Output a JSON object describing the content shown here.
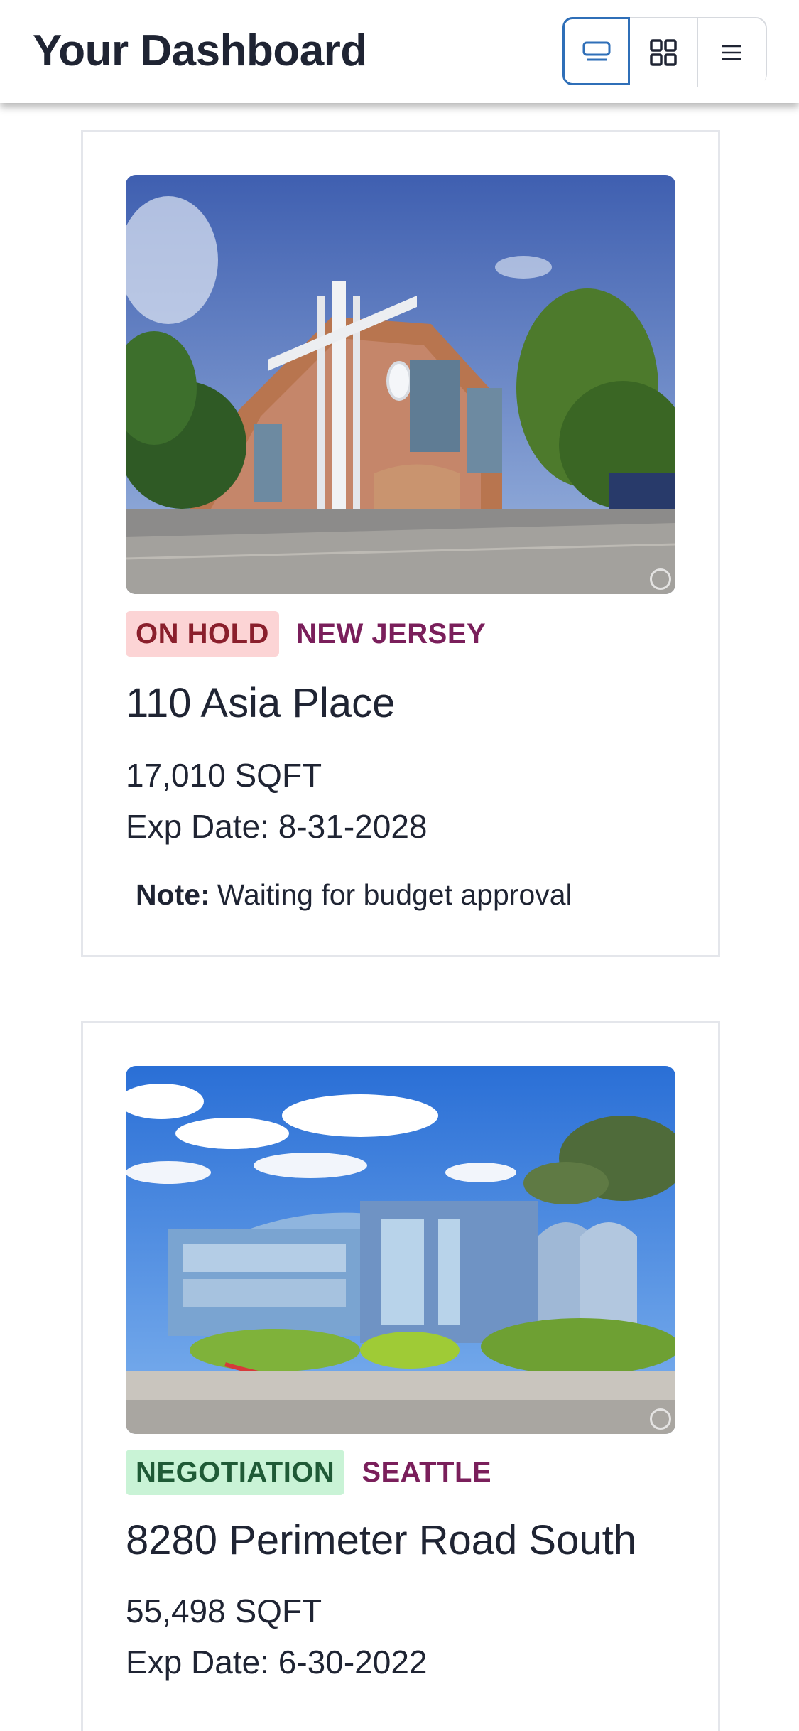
{
  "header": {
    "title": "Your Dashboard",
    "view_buttons": [
      {
        "icon": "card-view-icon",
        "active": true
      },
      {
        "icon": "grid-view-icon",
        "active": false
      },
      {
        "icon": "list-view-icon",
        "active": false
      }
    ]
  },
  "properties": [
    {
      "status": "ON HOLD",
      "location": "NEW JERSEY",
      "name": "110 Asia Place",
      "sqft": "17,010 SQFT",
      "exp": "Exp Date: 8-31-2028",
      "note_label": "Note:",
      "note_text": "Waiting for budget approval"
    },
    {
      "status": "NEGOTIATION",
      "location": "SEATTLE",
      "name": "8280 Perimeter Road South",
      "sqft": "55,498 SQFT",
      "exp": "Exp Date: 6-30-2022"
    }
  ],
  "colors": {
    "accent": "#2f6fb8",
    "on_hold_bg": "#fcd4d5",
    "on_hold_text": "#8a1f2c",
    "negotiation_bg": "#c9f3d6",
    "negotiation_text": "#1f5a36",
    "location_text": "#7a1f5b"
  }
}
